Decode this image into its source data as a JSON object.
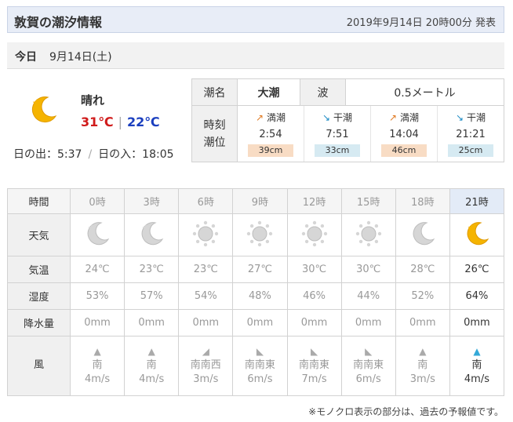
{
  "header": {
    "title": "敦賀の潮汐情報",
    "issued": "2019年9月14日 20時00分 発表"
  },
  "today": {
    "label": "今日",
    "date": "9月14日(土)"
  },
  "summary": {
    "weather": "晴れ",
    "weather_icon": "moon-star-icon",
    "temp_max": "31℃",
    "temp_sep": "|",
    "temp_min": "22℃",
    "sunrise": "日の出：5:37",
    "sep": "/",
    "sunset": "日の入：18:05"
  },
  "tide": {
    "name_label": "潮名",
    "name_value": "大潮",
    "wave_label": "波",
    "wave_value": "0.5メートル",
    "time_label": "時刻",
    "level_label": "潮位",
    "events": [
      {
        "arrow": "↗",
        "type": "満潮",
        "time": "2:54",
        "level": "39cm",
        "kind": "high"
      },
      {
        "arrow": "↘",
        "type": "干潮",
        "time": "7:51",
        "level": "33cm",
        "kind": "low"
      },
      {
        "arrow": "↗",
        "type": "満潮",
        "time": "14:04",
        "level": "46cm",
        "kind": "high"
      },
      {
        "arrow": "↘",
        "type": "干潮",
        "time": "21:21",
        "level": "25cm",
        "kind": "low"
      }
    ]
  },
  "hourly": {
    "labels": {
      "time": "時間",
      "weather": "天気",
      "temp": "気温",
      "humidity": "湿度",
      "rain": "降水量",
      "wind": "風"
    },
    "rows": [
      {
        "time": "0時",
        "icon": "moon-star-icon",
        "temp": "24℃",
        "humidity": "53%",
        "rain": "0mm",
        "wind_dir": "南",
        "wind_speed": "4m/s",
        "arrow": "▲"
      },
      {
        "time": "3時",
        "icon": "moon-star-icon",
        "temp": "23℃",
        "humidity": "57%",
        "rain": "0mm",
        "wind_dir": "南",
        "wind_speed": "4m/s",
        "arrow": "▲"
      },
      {
        "time": "6時",
        "icon": "sun-icon",
        "temp": "23℃",
        "humidity": "54%",
        "rain": "0mm",
        "wind_dir": "南南西",
        "wind_speed": "3m/s",
        "arrow": "◢"
      },
      {
        "time": "9時",
        "icon": "sun-icon",
        "temp": "27℃",
        "humidity": "48%",
        "rain": "0mm",
        "wind_dir": "南南東",
        "wind_speed": "6m/s",
        "arrow": "◣"
      },
      {
        "time": "12時",
        "icon": "sun-icon",
        "temp": "30℃",
        "humidity": "46%",
        "rain": "0mm",
        "wind_dir": "南南東",
        "wind_speed": "7m/s",
        "arrow": "◣"
      },
      {
        "time": "15時",
        "icon": "sun-icon",
        "temp": "30℃",
        "humidity": "44%",
        "rain": "0mm",
        "wind_dir": "南南東",
        "wind_speed": "6m/s",
        "arrow": "◣"
      },
      {
        "time": "18時",
        "icon": "moon-icon",
        "temp": "28℃",
        "humidity": "52%",
        "rain": "0mm",
        "wind_dir": "南",
        "wind_speed": "3m/s",
        "arrow": "▲"
      },
      {
        "time": "21時",
        "icon": "moon-star-icon",
        "temp": "26℃",
        "humidity": "64%",
        "rain": "0mm",
        "wind_dir": "南",
        "wind_speed": "4m/s",
        "arrow": "▲",
        "current": true
      }
    ]
  },
  "note": "※モノクロ表示の部分は、過去の予報値です。",
  "colors": {
    "tmax": "#d01b1b",
    "tmin": "#1b3fbf",
    "moon": "#f5b400",
    "high_level": "#f8dcc4",
    "low_level": "#d6eaf2",
    "header_bg": "#e8edf7"
  }
}
